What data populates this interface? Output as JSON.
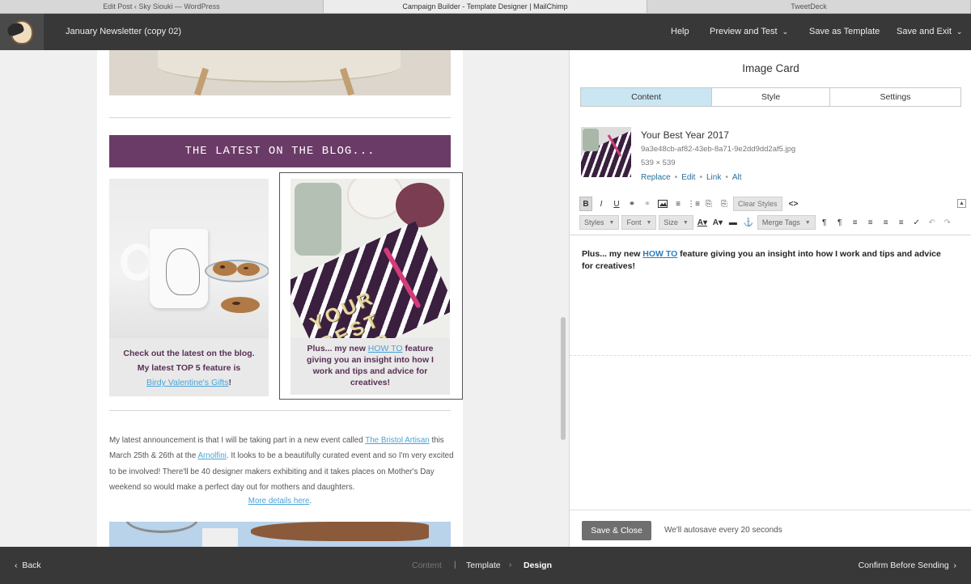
{
  "browser": {
    "tabs": [
      "Edit Post ‹ Sky Siouki — WordPress",
      "Campaign Builder - Template Designer | MailChimp",
      "TweetDeck"
    ]
  },
  "header": {
    "campaign_name": "January Newsletter (copy 02)",
    "help": "Help",
    "preview_test": "Preview and Test",
    "save_template": "Save as Template",
    "save_exit": "Save and Exit"
  },
  "email": {
    "blog_banner": "THE LATEST ON THE BLOG...",
    "card1": {
      "line1": "Check out the latest on the blog.",
      "line2": "My latest TOP 5 feature is",
      "link": "Birdy Valentine's Gifts",
      "after": "!"
    },
    "card2": {
      "pre": "Plus... my new ",
      "link": "HOW TO",
      "post": " feature giving you an insight into how I work and tips and advice for creatives!",
      "image_letters": "YOUR BEST YEAR"
    },
    "para": {
      "t1": "My latest announcement is that I will be taking part in a new event called ",
      "link1": "The Bristol Artisan",
      "t2": " this March 25th & 26th at the ",
      "link2": "Arnolfini",
      "t3": ". It looks to be a beautifully curated event and so I'm very excited to be involved! There'll be 40 designer makers exhibiting and it takes places on Mother's Day weekend so would make a perfect day out for mothers and daughters."
    },
    "more_link": "More details here",
    "more_after": "."
  },
  "editor": {
    "title": "Image Card",
    "tabs": [
      "Content",
      "Style",
      "Settings"
    ],
    "image": {
      "title": "Your Best Year 2017",
      "file": "9a3e48cb-af82-43eb-8a71-9e2dd9dd2af5.jpg",
      "dimensions": "539 × 539",
      "actions": [
        "Replace",
        "Edit",
        "Link",
        "Alt"
      ]
    },
    "toolbar": {
      "clear_styles": "Clear Styles",
      "styles": "Styles",
      "font": "Font",
      "size": "Size",
      "merge_tags": "Merge Tags"
    },
    "content": {
      "pre": "Plus... my new ",
      "link": "HOW TO",
      "post": " feature giving you an insight into how I work and tips and advice for creatives!"
    },
    "save_close": "Save & Close",
    "autosave": "We'll autosave every 20 seconds"
  },
  "footer": {
    "back": "Back",
    "steps": [
      "Content",
      "Template",
      "Design"
    ],
    "confirm": "Confirm Before Sending"
  }
}
